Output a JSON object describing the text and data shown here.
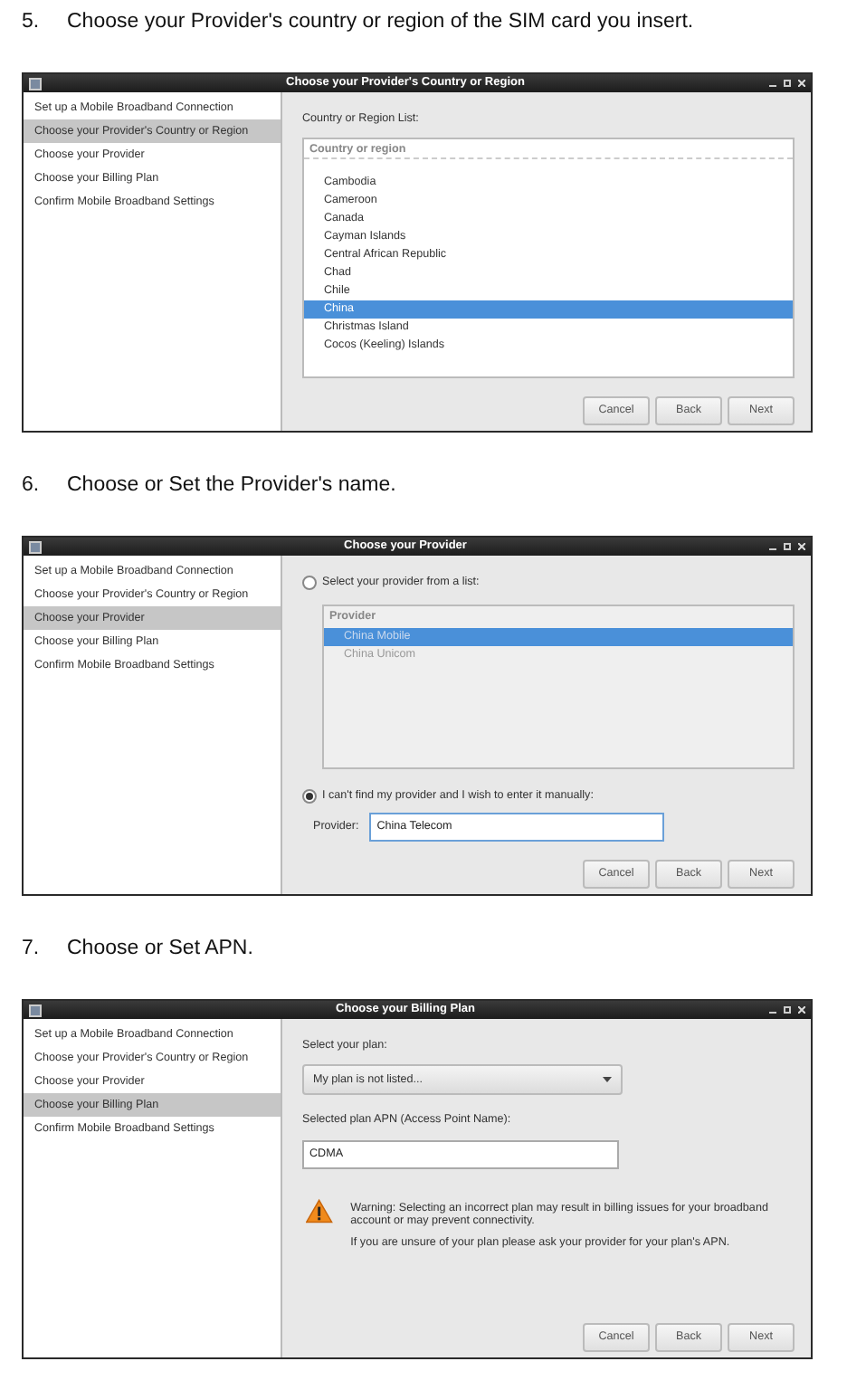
{
  "steps": [
    {
      "number": "5.",
      "text": "Choose your Provider's country or region of the SIM card you insert.",
      "window": {
        "title": "Choose your Provider's Country or Region",
        "sidebar": [
          {
            "label": "Set up a Mobile Broadband Connection",
            "selected": false
          },
          {
            "label": "Choose your Provider's Country or Region",
            "selected": true
          },
          {
            "label": "Choose your Provider",
            "selected": false
          },
          {
            "label": "Choose your Billing Plan",
            "selected": false
          },
          {
            "label": "Confirm Mobile Broadband Settings",
            "selected": false
          }
        ],
        "content": [
          {
            "kind": "label",
            "text": "Country or Region List:"
          },
          {
            "kind": "listbox",
            "header": "Country or region",
            "disabled": false,
            "items": [
              {
                "label": "Cambodia",
                "selected": false
              },
              {
                "label": "Cameroon",
                "selected": false
              },
              {
                "label": "Canada",
                "selected": false
              },
              {
                "label": "Cayman Islands",
                "selected": false
              },
              {
                "label": "Central African Republic",
                "selected": false
              },
              {
                "label": "Chad",
                "selected": false
              },
              {
                "label": "Chile",
                "selected": false
              },
              {
                "label": "China",
                "selected": true
              },
              {
                "label": "Christmas Island",
                "selected": false
              },
              {
                "label": "Cocos (Keeling) Islands",
                "selected": false
              }
            ]
          }
        ],
        "buttons": [
          "Cancel",
          "Back",
          "Next"
        ]
      }
    },
    {
      "number": "6.",
      "text": "Choose or Set the Provider's name.",
      "window": {
        "title": "Choose your Provider",
        "sidebar": [
          {
            "label": "Set up a Mobile Broadband Connection",
            "selected": false
          },
          {
            "label": "Choose your Provider's Country or Region",
            "selected": false
          },
          {
            "label": "Choose your Provider",
            "selected": true
          },
          {
            "label": "Choose your Billing Plan",
            "selected": false
          },
          {
            "label": "Confirm Mobile Broadband Settings",
            "selected": false
          }
        ],
        "content": [
          {
            "kind": "radio",
            "label": "Select your provider from a list:",
            "checked": false
          },
          {
            "kind": "listbox",
            "header": "Provider",
            "disabled": true,
            "items": [
              {
                "label": "China Mobile",
                "selected": true
              },
              {
                "label": "China Unicom",
                "selected": false
              }
            ]
          },
          {
            "kind": "radio",
            "label": "I can't find my provider and I wish to enter it manually:",
            "checked": true
          },
          {
            "kind": "field",
            "label": "Provider:",
            "value": "China Telecom",
            "focused": true
          }
        ],
        "buttons": [
          "Cancel",
          "Back",
          "Next"
        ]
      }
    },
    {
      "number": "7.",
      "text": "Choose or Set APN.",
      "window": {
        "title": "Choose your Billing Plan",
        "sidebar": [
          {
            "label": "Set up a Mobile Broadband Connection",
            "selected": false
          },
          {
            "label": "Choose your Provider's Country or Region",
            "selected": false
          },
          {
            "label": "Choose your Provider",
            "selected": false
          },
          {
            "label": "Choose your Billing Plan",
            "selected": true
          },
          {
            "label": "Confirm Mobile Broadband Settings",
            "selected": false
          }
        ],
        "content": [
          {
            "kind": "label",
            "text": "Select your plan:"
          },
          {
            "kind": "dropdown",
            "value": "My plan is not listed..."
          },
          {
            "kind": "label",
            "text": "Selected plan APN (Access Point Name):"
          },
          {
            "kind": "input",
            "value": "CDMA"
          },
          {
            "kind": "warning",
            "texts": [
              "Warning: Selecting an incorrect plan may result in billing issues for your broadband account or may prevent connectivity.",
              "If you are unsure of your plan please ask your provider for your plan's APN."
            ]
          }
        ],
        "buttons": [
          "Cancel",
          "Back",
          "Next"
        ]
      }
    }
  ]
}
